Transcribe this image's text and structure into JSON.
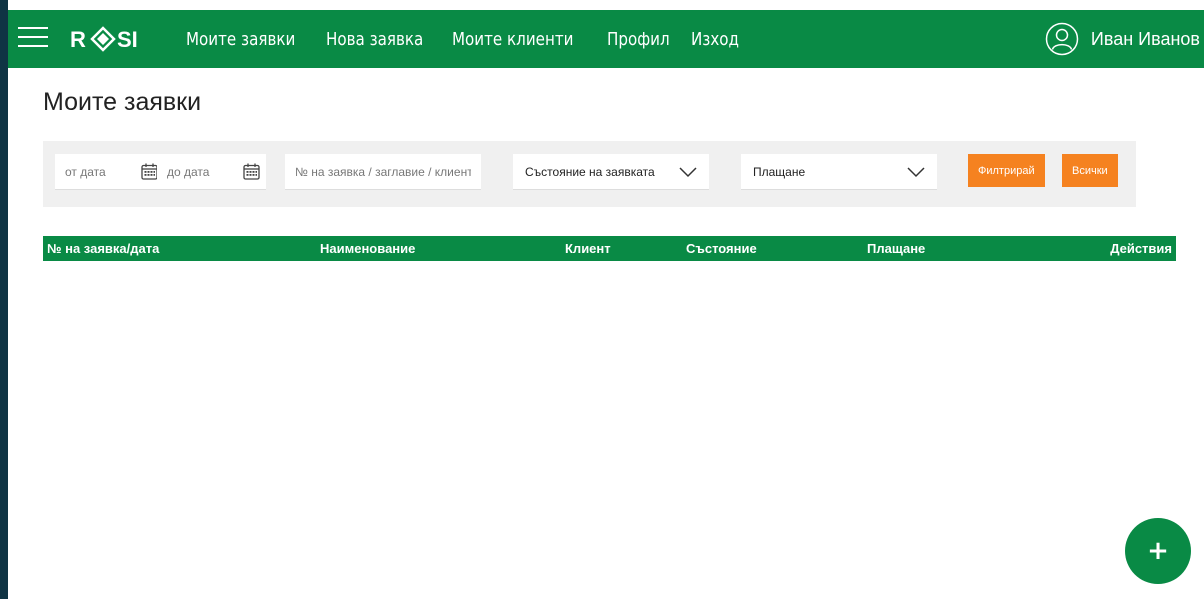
{
  "header": {
    "brand": "RØSI",
    "nav": [
      {
        "label": "Моите заявки"
      },
      {
        "label": "Нова заявка"
      },
      {
        "label": "Моите клиенти"
      },
      {
        "label": "Профил"
      },
      {
        "label": "Изход"
      }
    ],
    "user_name": "Иван Иванов"
  },
  "page": {
    "title": "Моите заявки"
  },
  "filters": {
    "from_date_placeholder": "от дата",
    "to_date_placeholder": "до дата",
    "search_placeholder": "№ на заявка / заглавие / клиент",
    "status_select": "Състояние на заявката",
    "payment_select": "Плащане",
    "filter_button": "Филтрирай",
    "all_button": "Всички"
  },
  "table": {
    "columns": [
      "№ на заявка/дата",
      "Наименование",
      "Клиент",
      "Състояние",
      "Плащане",
      "Действия"
    ]
  },
  "fab": {
    "label": "+"
  },
  "colors": {
    "primary_green": "#098a45",
    "accent_orange": "#f58220",
    "panel_gray": "#f0f0f0",
    "left_bar": "#0f3444"
  }
}
